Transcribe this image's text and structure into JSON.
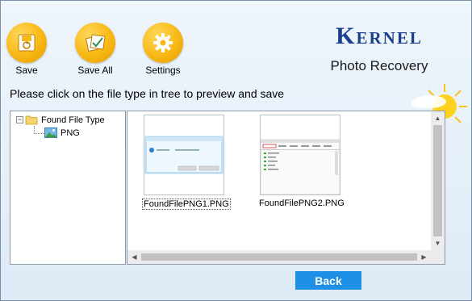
{
  "toolbar": {
    "save_label": "Save",
    "save_all_label": "Save All",
    "settings_label": "Settings"
  },
  "logo": {
    "brand": "Kernel",
    "product": "Photo Recovery"
  },
  "instruction": "Please click on the file type in tree to preview and save",
  "tree": {
    "root_label": "Found File Type",
    "root_expander": "−",
    "child_label": "PNG"
  },
  "thumbnails": [
    {
      "label": "FoundFilePNG1.PNG"
    },
    {
      "label": "FoundFilePNG2.PNG"
    }
  ],
  "scroll": {
    "up": "▲",
    "down": "▼",
    "left": "◀",
    "right": "▶"
  },
  "back_label": "Back",
  "colors": {
    "accent_button": "#1e90e6",
    "toolbar_icon": "#f8b814",
    "logo_text": "#1b3f8f"
  },
  "icons": {
    "save": "save-icon",
    "save_all": "save-all-icon",
    "settings": "gear-icon",
    "folder": "folder-icon",
    "image": "image-icon",
    "sun": "sun-icon"
  }
}
